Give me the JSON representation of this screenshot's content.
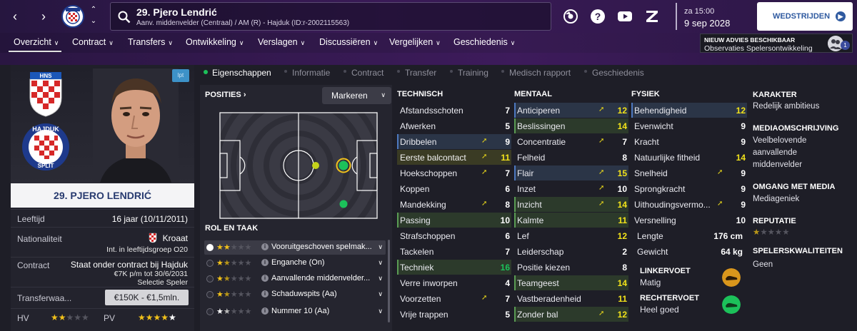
{
  "header": {
    "player_title": "29. Pjero Lendrić",
    "player_subtitle": "Aanv. middenvelder (Centraal) / AM (R) - Hajduk (ID:r-2002115563)",
    "time": "za 15:00",
    "date": "9 sep 2028",
    "matches_button": "WEDSTRIJDEN",
    "icons": [
      "back-icon",
      "forward-icon",
      "club-crest-icon",
      "up-down-icon",
      "search-icon",
      "fm-icon",
      "help-icon",
      "youtube-icon",
      "z-icon"
    ]
  },
  "nav": {
    "items": [
      "Overzicht",
      "Contract",
      "Transfers",
      "Ontwikkeling",
      "Verslagen",
      "Discussiëren",
      "Vergelijken",
      "Geschiedenis"
    ],
    "advice_title": "NIEUW ADVIES BESCHIKBAAR",
    "advice_text": "Observaties Spelersontwikkeling",
    "advice_count": "1"
  },
  "player": {
    "name": "29. PJERO LENDRIĆ",
    "badge": "lpt",
    "age_label": "Leeftijd",
    "age_value": "16 jaar (10/11/2011)",
    "nat_label": "Nationaliteit",
    "nat_value": "Kroaat",
    "nat_sub": "Int. in leeftijdsgroep O20",
    "contract_label": "Contract",
    "contract_line1": "Staat onder contract bij Hajduk",
    "contract_line2": "€7K p/m tot 30/6/2031",
    "contract_line3": "Selectie Speler",
    "value_label": "Transferwaa...",
    "value": "€150K - €1,5mln.",
    "hv_label": "HV",
    "hv_stars": 2,
    "pv_label": "PV",
    "pv_stars": 4.5
  },
  "tabs": [
    "Eigenschappen",
    "Informatie",
    "Contract",
    "Transfer",
    "Training",
    "Medisch rapport",
    "Geschiedenis"
  ],
  "positions": {
    "title": "POSITIES",
    "mark_button": "Markeren",
    "roles_title": "ROL EN TAAK",
    "roles": [
      {
        "label": "Vooruitgeschoven spelmak...",
        "stars": 2,
        "selected": true
      },
      {
        "label": "Enganche (On)",
        "stars": 1.5,
        "selected": false
      },
      {
        "label": "Aanvallende middenvelder...",
        "stars": 1.5,
        "selected": false
      },
      {
        "label": "Schaduwspits (Aa)",
        "stars": 1.5,
        "selected": false
      },
      {
        "label": "Nummer 10 (Aa)",
        "stars": 1.5,
        "selected": false
      }
    ]
  },
  "attributes": {
    "technical_title": "TECHNISCH",
    "mental_title": "MENTAAL",
    "physical_title": "FYSIEK",
    "technical": [
      {
        "name": "Afstandsschoten",
        "value": "7",
        "hl": "",
        "arrow": false
      },
      {
        "name": "Afwerken",
        "value": "5",
        "hl": "",
        "arrow": false
      },
      {
        "name": "Dribbelen",
        "value": "9",
        "hl": "blue",
        "arrow": true
      },
      {
        "name": "Eerste balcontact",
        "value": "11",
        "hl": "yel",
        "arrow": true
      },
      {
        "name": "Hoekschoppen",
        "value": "7",
        "hl": "",
        "arrow": true
      },
      {
        "name": "Koppen",
        "value": "6",
        "hl": "",
        "arrow": false
      },
      {
        "name": "Mandekking",
        "value": "8",
        "hl": "",
        "arrow": true
      },
      {
        "name": "Passing",
        "value": "10",
        "hl": "green",
        "arrow": false
      },
      {
        "name": "Strafschoppen",
        "value": "6",
        "hl": "",
        "arrow": false
      },
      {
        "name": "Tackelen",
        "value": "7",
        "hl": "",
        "arrow": false
      },
      {
        "name": "Techniek",
        "value": "16",
        "hl": "green",
        "arrow": false
      },
      {
        "name": "Verre inworpen",
        "value": "4",
        "hl": "",
        "arrow": false
      },
      {
        "name": "Voorzetten",
        "value": "7",
        "hl": "",
        "arrow": true
      },
      {
        "name": "Vrije trappen",
        "value": "5",
        "hl": "",
        "arrow": false
      }
    ],
    "mental": [
      {
        "name": "Anticiperen",
        "value": "12",
        "hl": "blue",
        "arrow": true
      },
      {
        "name": "Beslissingen",
        "value": "14",
        "hl": "green",
        "arrow": false
      },
      {
        "name": "Concentratie",
        "value": "7",
        "hl": "",
        "arrow": true
      },
      {
        "name": "Felheid",
        "value": "8",
        "hl": "",
        "arrow": false
      },
      {
        "name": "Flair",
        "value": "15",
        "hl": "blue",
        "arrow": true
      },
      {
        "name": "Inzet",
        "value": "10",
        "hl": "",
        "arrow": true
      },
      {
        "name": "Inzicht",
        "value": "14",
        "hl": "green",
        "arrow": true
      },
      {
        "name": "Kalmte",
        "value": "11",
        "hl": "green",
        "arrow": false
      },
      {
        "name": "Lef",
        "value": "12",
        "hl": "",
        "arrow": false
      },
      {
        "name": "Leiderschap",
        "value": "2",
        "hl": "",
        "arrow": false
      },
      {
        "name": "Positie kiezen",
        "value": "8",
        "hl": "",
        "arrow": false
      },
      {
        "name": "Teamgeest",
        "value": "14",
        "hl": "green",
        "arrow": false
      },
      {
        "name": "Vastberadenheid",
        "value": "11",
        "hl": "",
        "arrow": false
      },
      {
        "name": "Zonder bal",
        "value": "12",
        "hl": "green",
        "arrow": true
      }
    ],
    "physical": [
      {
        "name": "Behendigheid",
        "value": "12",
        "hl": "blue",
        "arrow": false
      },
      {
        "name": "Evenwicht",
        "value": "9",
        "hl": "",
        "arrow": false
      },
      {
        "name": "Kracht",
        "value": "9",
        "hl": "",
        "arrow": false
      },
      {
        "name": "Natuurlijke fitheid",
        "value": "14",
        "hl": "",
        "arrow": false
      },
      {
        "name": "Snelheid",
        "value": "9",
        "hl": "",
        "arrow": true
      },
      {
        "name": "Sprongkracht",
        "value": "9",
        "hl": "",
        "arrow": false
      },
      {
        "name": "Uithoudingsvermo...",
        "value": "9",
        "hl": "",
        "arrow": true
      },
      {
        "name": "Versnelling",
        "value": "10",
        "hl": "",
        "arrow": false
      }
    ],
    "height_label": "Lengte",
    "height_value": "176 cm",
    "weight_label": "Gewicht",
    "weight_value": "64 kg",
    "left_foot_label": "LINKERVOET",
    "left_foot_value": "Matig",
    "right_foot_label": "RECHTERVOET",
    "right_foot_value": "Heel goed"
  },
  "side": {
    "character_title": "KARAKTER",
    "character_value": "Redelijk ambitieus",
    "media_title": "MEDIAOMSCHRIJVING",
    "media_value_1": "Veelbelovende",
    "media_value_2": "aanvallende",
    "media_value_3": "middenvelder",
    "media_handling_title": "OMGANG MET MEDIA",
    "media_handling_value": "Mediageniek",
    "reputation_title": "REPUTATIE",
    "reputation_stars": 0.5,
    "qualities_title": "SPELERSKWALITEITEN",
    "qualities_value": "Geen"
  },
  "colors": {
    "accent_blue": "#2f5aa0",
    "highlight_green": "#1cc15a",
    "star_gold": "#f2c21a",
    "arrow_yellow": "#e6d51b"
  }
}
